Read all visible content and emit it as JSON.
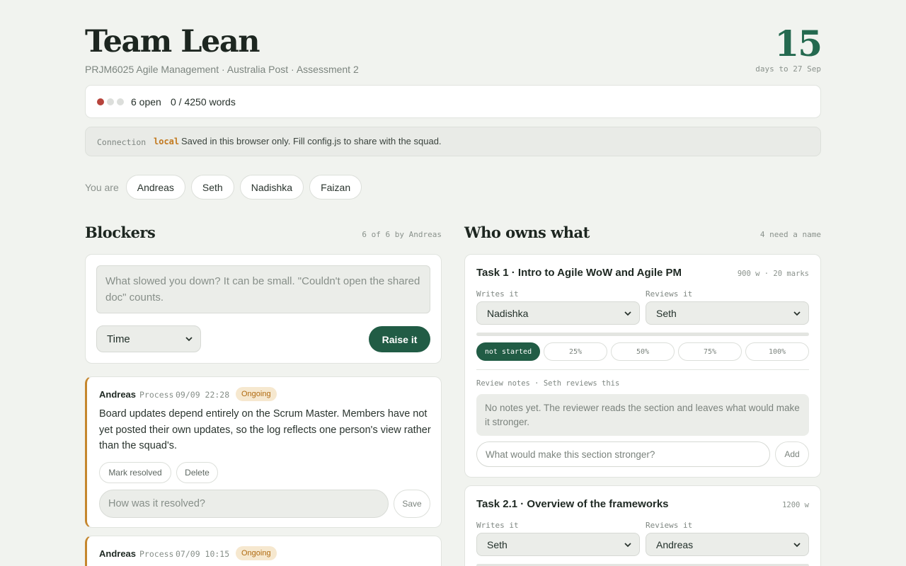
{
  "header": {
    "title": "Team Lean",
    "subtitle": "PRJM6025 Agile Management · Australia Post · Assessment 2",
    "countdown_value": "15",
    "countdown_label": "days to 27 Sep"
  },
  "status": {
    "dots": [
      "red",
      "grey",
      "grey"
    ],
    "open_count": "6 open",
    "word_count": "0 / 4250 words"
  },
  "connection": {
    "label": "Connection",
    "mode": "local",
    "message": "Saved in this browser only. Fill config.js to share with the squad."
  },
  "identity": {
    "label": "You are",
    "members": [
      "Andreas",
      "Seth",
      "Nadishka",
      "Faizan"
    ]
  },
  "blockers": {
    "title": "Blockers",
    "meta": "6 of 6 by Andreas",
    "new": {
      "placeholder": "What slowed you down? It can be small. \"Couldn't open the shared doc\" counts.",
      "category": "Time",
      "submit_label": "Raise it"
    },
    "items": [
      {
        "author": "Andreas",
        "category": "Process",
        "time": "09/09 22:28",
        "status": "Ongoing",
        "text": "Board updates depend entirely on the Scrum Master. Members have not yet posted their own updates, so the log reflects one person's view rather than the squad's.",
        "resolve_label": "Mark resolved",
        "delete_label": "Delete",
        "resolution_placeholder": "How was it resolved?",
        "save_label": "Save"
      },
      {
        "author": "Andreas",
        "category": "Process",
        "time": "07/09 10:15",
        "status": "Ongoing"
      }
    ]
  },
  "ownership": {
    "title": "Who owns what",
    "meta": "4 need a name",
    "writes_label": "Writes it",
    "reviews_label": "Reviews it",
    "tasks": [
      {
        "title": "Task 1 · Intro to Agile WoW and Agile PM",
        "meta": "900 w · 20 marks",
        "writer": "Nadishka",
        "reviewer": "Seth",
        "progress": 0,
        "stages": [
          "not started",
          "25%",
          "50%",
          "75%",
          "100%"
        ],
        "active_stage": "not started",
        "review_label": "Review notes · Seth reviews this",
        "notes_empty": "No notes yet. The reviewer reads the section and leaves what would make it stronger.",
        "note_placeholder": "What would make this section stronger?",
        "add_label": "Add"
      },
      {
        "title": "Task 2.1 · Overview of the frameworks",
        "meta": "1200 w",
        "writer": "Seth",
        "reviewer": "Andreas"
      }
    ]
  },
  "colors": {
    "accent": "#215c45",
    "warning": "#c5862e",
    "danger": "#b7443c",
    "background": "#f1f3ef"
  }
}
